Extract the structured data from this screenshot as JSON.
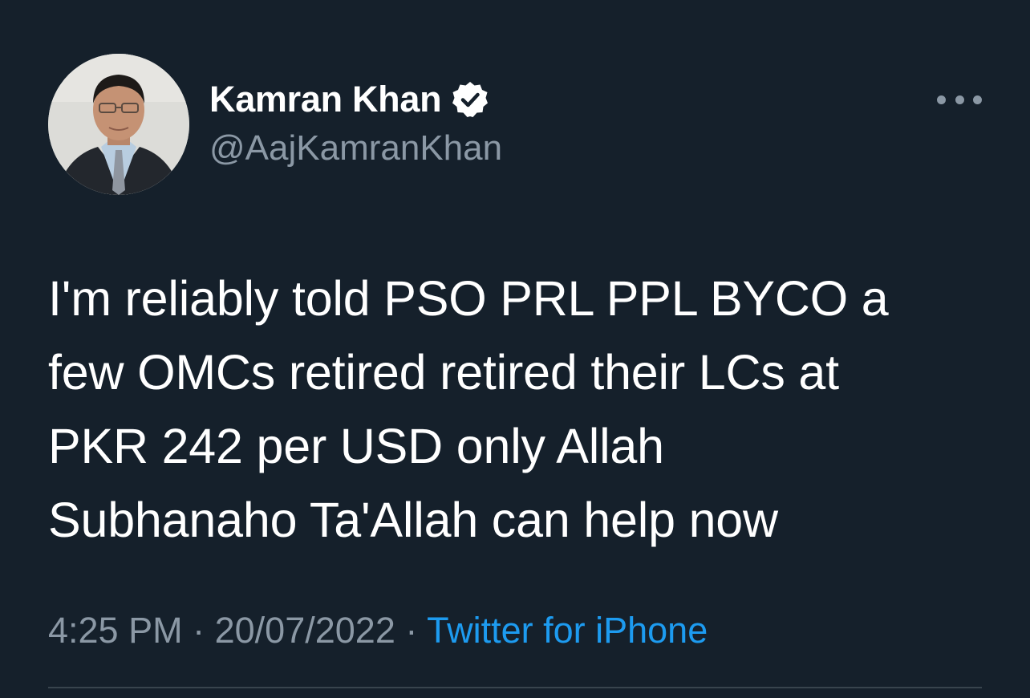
{
  "user": {
    "display_name": "Kamran Khan",
    "handle": "@AajKamranKhan",
    "verified": true,
    "avatar": "profile-photo"
  },
  "tweet": {
    "lines": [
      "I'm reliably told PSO PRL PPL BYCO a",
      "few OMCs retired retired their LCs at",
      "PKR 242 per USD only Allah",
      "Subhanaho Ta'Allah can help now"
    ]
  },
  "meta": {
    "time": "4:25 PM",
    "separator": "·",
    "date": "20/07/2022",
    "source": "Twitter for iPhone"
  },
  "icons": {
    "more": "more-options-icon",
    "verified": "verified-badge-icon"
  },
  "colors": {
    "background": "#15202b",
    "primary_text": "#ffffff",
    "secondary_text": "#8b98a5",
    "link": "#1d9bf0",
    "divider": "#38444d"
  }
}
